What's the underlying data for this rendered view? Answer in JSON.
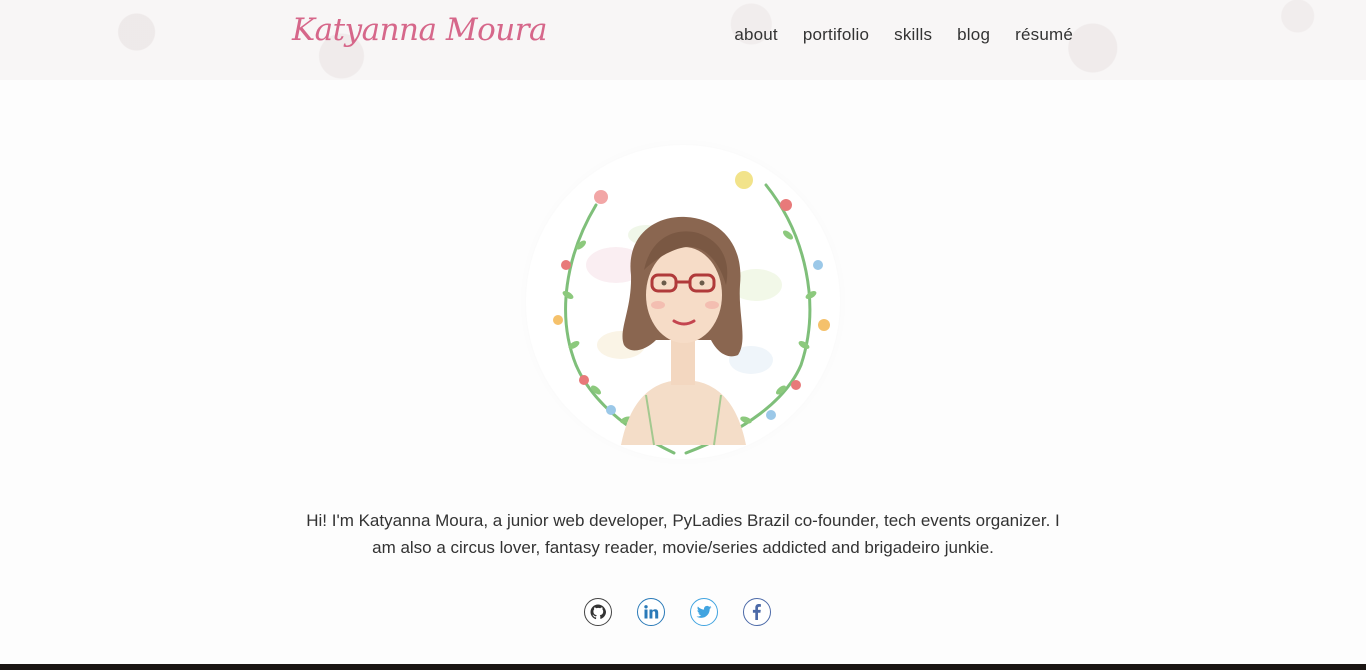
{
  "header": {
    "brand": "Katyanna Moura",
    "nav": [
      {
        "label": "about"
      },
      {
        "label": "portifolio"
      },
      {
        "label": "skills"
      },
      {
        "label": "blog"
      },
      {
        "label": "résumé"
      }
    ]
  },
  "main": {
    "bio": "Hi! I'm Katyanna Moura, a junior web developer, PyLadies Brazil co-founder, tech events organizer. I am also a circus lover, fantasy reader, movie/series addicted and brigadeiro junkie."
  },
  "social": [
    {
      "icon": "github-icon",
      "color": "#333333"
    },
    {
      "icon": "linkedin-icon",
      "color": "#2a7ab8"
    },
    {
      "icon": "twitter-icon",
      "color": "#41a4e0"
    },
    {
      "icon": "facebook-icon",
      "color": "#4c6aa8"
    }
  ],
  "colors": {
    "brand": "#d6678a",
    "text": "#333333",
    "background": "#fdfdfd"
  }
}
